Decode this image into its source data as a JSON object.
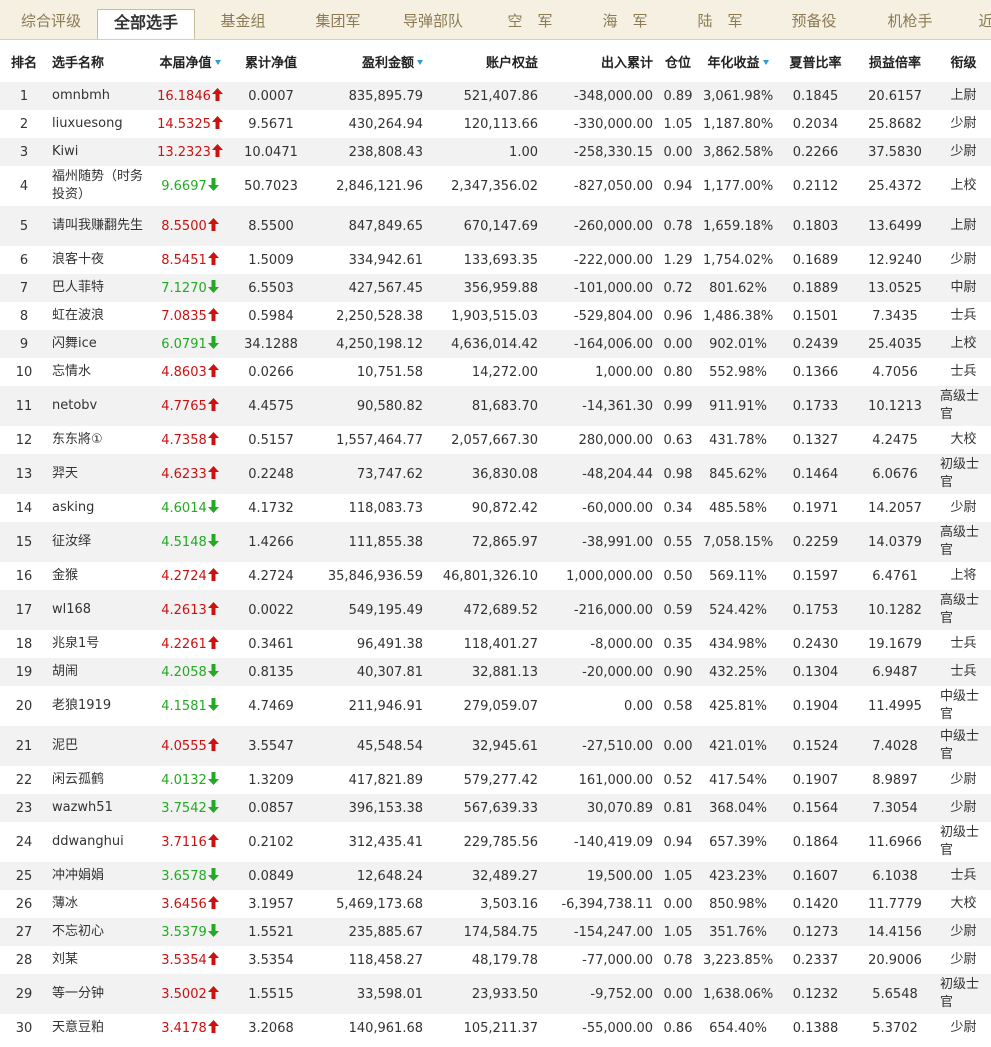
{
  "tabs": [
    {
      "label": "综合评级",
      "active": false
    },
    {
      "label": "全部选手",
      "active": true
    },
    {
      "label": "基金组",
      "active": false
    },
    {
      "label": "集团军",
      "active": false
    },
    {
      "label": "导弹部队",
      "active": false
    },
    {
      "label": "空　军",
      "active": false
    },
    {
      "label": "海　军",
      "active": false
    },
    {
      "label": "陆　军",
      "active": false
    },
    {
      "label": "预备役",
      "active": false
    },
    {
      "label": "机枪手",
      "active": false
    },
    {
      "label": "近",
      "active": false
    }
  ],
  "columns": [
    {
      "label": "排名",
      "sortable": false
    },
    {
      "label": "选手名称",
      "sortable": false
    },
    {
      "label": "本届净值",
      "sortable": true
    },
    {
      "label": "累计净值",
      "sortable": false
    },
    {
      "label": "盈利金额",
      "sortable": true
    },
    {
      "label": "账户权益",
      "sortable": false
    },
    {
      "label": "出入累计",
      "sortable": false
    },
    {
      "label": "仓位",
      "sortable": false
    },
    {
      "label": "年化收益",
      "sortable": true
    },
    {
      "label": "夏普比率",
      "sortable": false
    },
    {
      "label": "损益倍率",
      "sortable": false
    },
    {
      "label": "衔级",
      "sortable": false
    }
  ],
  "colors": {
    "up": "#cc1111",
    "down": "#22aa22",
    "sort_arrow": "#2a9fd6"
  },
  "rows": [
    {
      "rank": "1",
      "name": "omnbmh",
      "nav": "16.1846",
      "trend": "up",
      "cum_nav": "0.0007",
      "profit": "835,895.79",
      "equity": "521,407.86",
      "flow": "-348,000.00",
      "position": "0.89",
      "annual": "3,061.98%",
      "sharpe": "0.1845",
      "pl_ratio": "20.6157",
      "rank_title": "上尉"
    },
    {
      "rank": "2",
      "name": "liuxuesong",
      "nav": "14.5325",
      "trend": "up",
      "cum_nav": "9.5671",
      "profit": "430,264.94",
      "equity": "120,113.66",
      "flow": "-330,000.00",
      "position": "1.05",
      "annual": "1,187.80%",
      "sharpe": "0.2034",
      "pl_ratio": "25.8682",
      "rank_title": "少尉"
    },
    {
      "rank": "3",
      "name": "Kiwi",
      "nav": "13.2323",
      "trend": "up",
      "cum_nav": "10.0471",
      "profit": "238,808.43",
      "equity": "1.00",
      "flow": "-258,330.15",
      "position": "0.00",
      "annual": "3,862.58%",
      "sharpe": "0.2266",
      "pl_ratio": "37.5830",
      "rank_title": "少尉"
    },
    {
      "rank": "4",
      "name": "福州随势（时务投资）",
      "nav": "9.6697",
      "trend": "down",
      "cum_nav": "50.7023",
      "profit": "2,846,121.96",
      "equity": "2,347,356.02",
      "flow": "-827,050.00",
      "position": "0.94",
      "annual": "1,177.00%",
      "sharpe": "0.2112",
      "pl_ratio": "25.4372",
      "rank_title": "上校"
    },
    {
      "rank": "5",
      "name": "请叫我赚翻先生",
      "nav": "8.5500",
      "trend": "up",
      "cum_nav": "8.5500",
      "profit": "847,849.65",
      "equity": "670,147.69",
      "flow": "-260,000.00",
      "position": "0.78",
      "annual": "1,659.18%",
      "sharpe": "0.1803",
      "pl_ratio": "13.6499",
      "rank_title": "上尉"
    },
    {
      "rank": "6",
      "name": "浪客十夜",
      "nav": "8.5451",
      "trend": "up",
      "cum_nav": "1.5009",
      "profit": "334,942.61",
      "equity": "133,693.35",
      "flow": "-222,000.00",
      "position": "1.29",
      "annual": "1,754.02%",
      "sharpe": "0.1689",
      "pl_ratio": "12.9240",
      "rank_title": "少尉"
    },
    {
      "rank": "7",
      "name": "巴人菲特",
      "nav": "7.1270",
      "trend": "down",
      "cum_nav": "6.5503",
      "profit": "427,567.45",
      "equity": "356,959.88",
      "flow": "-101,000.00",
      "position": "0.72",
      "annual": "801.62%",
      "sharpe": "0.1889",
      "pl_ratio": "13.0525",
      "rank_title": "中尉"
    },
    {
      "rank": "8",
      "name": "虹在波浪",
      "nav": "7.0835",
      "trend": "up",
      "cum_nav": "0.5984",
      "profit": "2,250,528.38",
      "equity": "1,903,515.03",
      "flow": "-529,804.00",
      "position": "0.96",
      "annual": "1,486.38%",
      "sharpe": "0.1501",
      "pl_ratio": "7.3435",
      "rank_title": "士兵"
    },
    {
      "rank": "9",
      "name": "闪舞ice",
      "nav": "6.0791",
      "trend": "down",
      "cum_nav": "34.1288",
      "profit": "4,250,198.12",
      "equity": "4,636,014.42",
      "flow": "-164,006.00",
      "position": "0.00",
      "annual": "902.01%",
      "sharpe": "0.2439",
      "pl_ratio": "25.4035",
      "rank_title": "上校"
    },
    {
      "rank": "10",
      "name": "忘情水",
      "nav": "4.8603",
      "trend": "up",
      "cum_nav": "0.0266",
      "profit": "10,751.58",
      "equity": "14,272.00",
      "flow": "1,000.00",
      "position": "0.80",
      "annual": "552.98%",
      "sharpe": "0.1366",
      "pl_ratio": "4.7056",
      "rank_title": "士兵"
    },
    {
      "rank": "11",
      "name": "netobv",
      "nav": "4.7765",
      "trend": "up",
      "cum_nav": "4.4575",
      "profit": "90,580.82",
      "equity": "81,683.70",
      "flow": "-14,361.30",
      "position": "0.99",
      "annual": "911.91%",
      "sharpe": "0.1733",
      "pl_ratio": "10.1213",
      "rank_title": "高级士官"
    },
    {
      "rank": "12",
      "name": "东东將①",
      "nav": "4.7358",
      "trend": "up",
      "cum_nav": "0.5157",
      "profit": "1,557,464.77",
      "equity": "2,057,667.30",
      "flow": "280,000.00",
      "position": "0.63",
      "annual": "431.78%",
      "sharpe": "0.1327",
      "pl_ratio": "4.2475",
      "rank_title": "大校"
    },
    {
      "rank": "13",
      "name": "羿天",
      "nav": "4.6233",
      "trend": "up",
      "cum_nav": "0.2248",
      "profit": "73,747.62",
      "equity": "36,830.08",
      "flow": "-48,204.44",
      "position": "0.98",
      "annual": "845.62%",
      "sharpe": "0.1464",
      "pl_ratio": "6.0676",
      "rank_title": "初级士官"
    },
    {
      "rank": "14",
      "name": "asking",
      "nav": "4.6014",
      "trend": "down",
      "cum_nav": "4.1732",
      "profit": "118,083.73",
      "equity": "90,872.42",
      "flow": "-60,000.00",
      "position": "0.34",
      "annual": "485.58%",
      "sharpe": "0.1971",
      "pl_ratio": "14.2057",
      "rank_title": "少尉"
    },
    {
      "rank": "15",
      "name": "征汝绎",
      "nav": "4.5148",
      "trend": "down",
      "cum_nav": "1.4266",
      "profit": "111,855.38",
      "equity": "72,865.97",
      "flow": "-38,991.00",
      "position": "0.55",
      "annual": "7,058.15%",
      "sharpe": "0.2259",
      "pl_ratio": "14.0379",
      "rank_title": "高级士官"
    },
    {
      "rank": "16",
      "name": "金猴",
      "nav": "4.2724",
      "trend": "up",
      "cum_nav": "4.2724",
      "profit": "35,846,936.59",
      "equity": "46,801,326.10",
      "flow": "1,000,000.00",
      "position": "0.50",
      "annual": "569.11%",
      "sharpe": "0.1597",
      "pl_ratio": "6.4761",
      "rank_title": "上将"
    },
    {
      "rank": "17",
      "name": "wl168",
      "nav": "4.2613",
      "trend": "up",
      "cum_nav": "0.0022",
      "profit": "549,195.49",
      "equity": "472,689.52",
      "flow": "-216,000.00",
      "position": "0.59",
      "annual": "524.42%",
      "sharpe": "0.1753",
      "pl_ratio": "10.1282",
      "rank_title": "高级士官"
    },
    {
      "rank": "18",
      "name": "兆泉1号",
      "nav": "4.2261",
      "trend": "up",
      "cum_nav": "0.3461",
      "profit": "96,491.38",
      "equity": "118,401.27",
      "flow": "-8,000.00",
      "position": "0.35",
      "annual": "434.98%",
      "sharpe": "0.2430",
      "pl_ratio": "19.1679",
      "rank_title": "士兵"
    },
    {
      "rank": "19",
      "name": "胡闹",
      "nav": "4.2058",
      "trend": "down",
      "cum_nav": "0.8135",
      "profit": "40,307.81",
      "equity": "32,881.13",
      "flow": "-20,000.00",
      "position": "0.90",
      "annual": "432.25%",
      "sharpe": "0.1304",
      "pl_ratio": "6.9487",
      "rank_title": "士兵"
    },
    {
      "rank": "20",
      "name": "老狼1919",
      "nav": "4.1581",
      "trend": "down",
      "cum_nav": "4.7469",
      "profit": "211,946.91",
      "equity": "279,059.07",
      "flow": "0.00",
      "position": "0.58",
      "annual": "425.81%",
      "sharpe": "0.1904",
      "pl_ratio": "11.4995",
      "rank_title": "中级士官"
    },
    {
      "rank": "21",
      "name": "泥巴",
      "nav": "4.0555",
      "trend": "up",
      "cum_nav": "3.5547",
      "profit": "45,548.54",
      "equity": "32,945.61",
      "flow": "-27,510.00",
      "position": "0.00",
      "annual": "421.01%",
      "sharpe": "0.1524",
      "pl_ratio": "7.4028",
      "rank_title": "中级士官"
    },
    {
      "rank": "22",
      "name": "闲云孤鹤",
      "nav": "4.0132",
      "trend": "down",
      "cum_nav": "1.3209",
      "profit": "417,821.89",
      "equity": "579,277.42",
      "flow": "161,000.00",
      "position": "0.52",
      "annual": "417.54%",
      "sharpe": "0.1907",
      "pl_ratio": "8.9897",
      "rank_title": "少尉"
    },
    {
      "rank": "23",
      "name": "wazwh51",
      "nav": "3.7542",
      "trend": "down",
      "cum_nav": "0.0857",
      "profit": "396,153.38",
      "equity": "567,639.33",
      "flow": "30,070.89",
      "position": "0.81",
      "annual": "368.04%",
      "sharpe": "0.1564",
      "pl_ratio": "7.3054",
      "rank_title": "少尉"
    },
    {
      "rank": "24",
      "name": "ddwanghui",
      "nav": "3.7116",
      "trend": "up",
      "cum_nav": "0.2102",
      "profit": "312,435.41",
      "equity": "229,785.56",
      "flow": "-140,419.09",
      "position": "0.94",
      "annual": "657.39%",
      "sharpe": "0.1864",
      "pl_ratio": "11.6966",
      "rank_title": "初级士官"
    },
    {
      "rank": "25",
      "name": "冲冲娟娟",
      "nav": "3.6578",
      "trend": "down",
      "cum_nav": "0.0849",
      "profit": "12,648.24",
      "equity": "32,489.27",
      "flow": "19,500.00",
      "position": "1.05",
      "annual": "423.23%",
      "sharpe": "0.1607",
      "pl_ratio": "6.1038",
      "rank_title": "士兵"
    },
    {
      "rank": "26",
      "name": "薄冰",
      "nav": "3.6456",
      "trend": "up",
      "cum_nav": "3.1957",
      "profit": "5,469,173.68",
      "equity": "3,503.16",
      "flow": "-6,394,738.11",
      "position": "0.00",
      "annual": "850.98%",
      "sharpe": "0.1420",
      "pl_ratio": "11.7779",
      "rank_title": "大校"
    },
    {
      "rank": "27",
      "name": "不忘初心",
      "nav": "3.5379",
      "trend": "down",
      "cum_nav": "1.5521",
      "profit": "235,885.67",
      "equity": "174,584.75",
      "flow": "-154,247.00",
      "position": "1.05",
      "annual": "351.76%",
      "sharpe": "0.1273",
      "pl_ratio": "14.4156",
      "rank_title": "少尉"
    },
    {
      "rank": "28",
      "name": "刘某",
      "nav": "3.5354",
      "trend": "up",
      "cum_nav": "3.5354",
      "profit": "118,458.27",
      "equity": "48,179.78",
      "flow": "-77,000.00",
      "position": "0.78",
      "annual": "3,223.85%",
      "sharpe": "0.2337",
      "pl_ratio": "20.9006",
      "rank_title": "少尉"
    },
    {
      "rank": "29",
      "name": "等一分钟",
      "nav": "3.5002",
      "trend": "up",
      "cum_nav": "1.5515",
      "profit": "33,598.01",
      "equity": "23,933.50",
      "flow": "-9,752.00",
      "position": "0.00",
      "annual": "1,638.06%",
      "sharpe": "0.1232",
      "pl_ratio": "5.6548",
      "rank_title": "初级士官"
    },
    {
      "rank": "30",
      "name": "天意豆粕",
      "nav": "3.4178",
      "trend": "up",
      "cum_nav": "3.2068",
      "profit": "140,961.68",
      "equity": "105,211.37",
      "flow": "-55,000.00",
      "position": "0.86",
      "annual": "654.40%",
      "sharpe": "0.1388",
      "pl_ratio": "5.3702",
      "rank_title": "少尉"
    }
  ]
}
